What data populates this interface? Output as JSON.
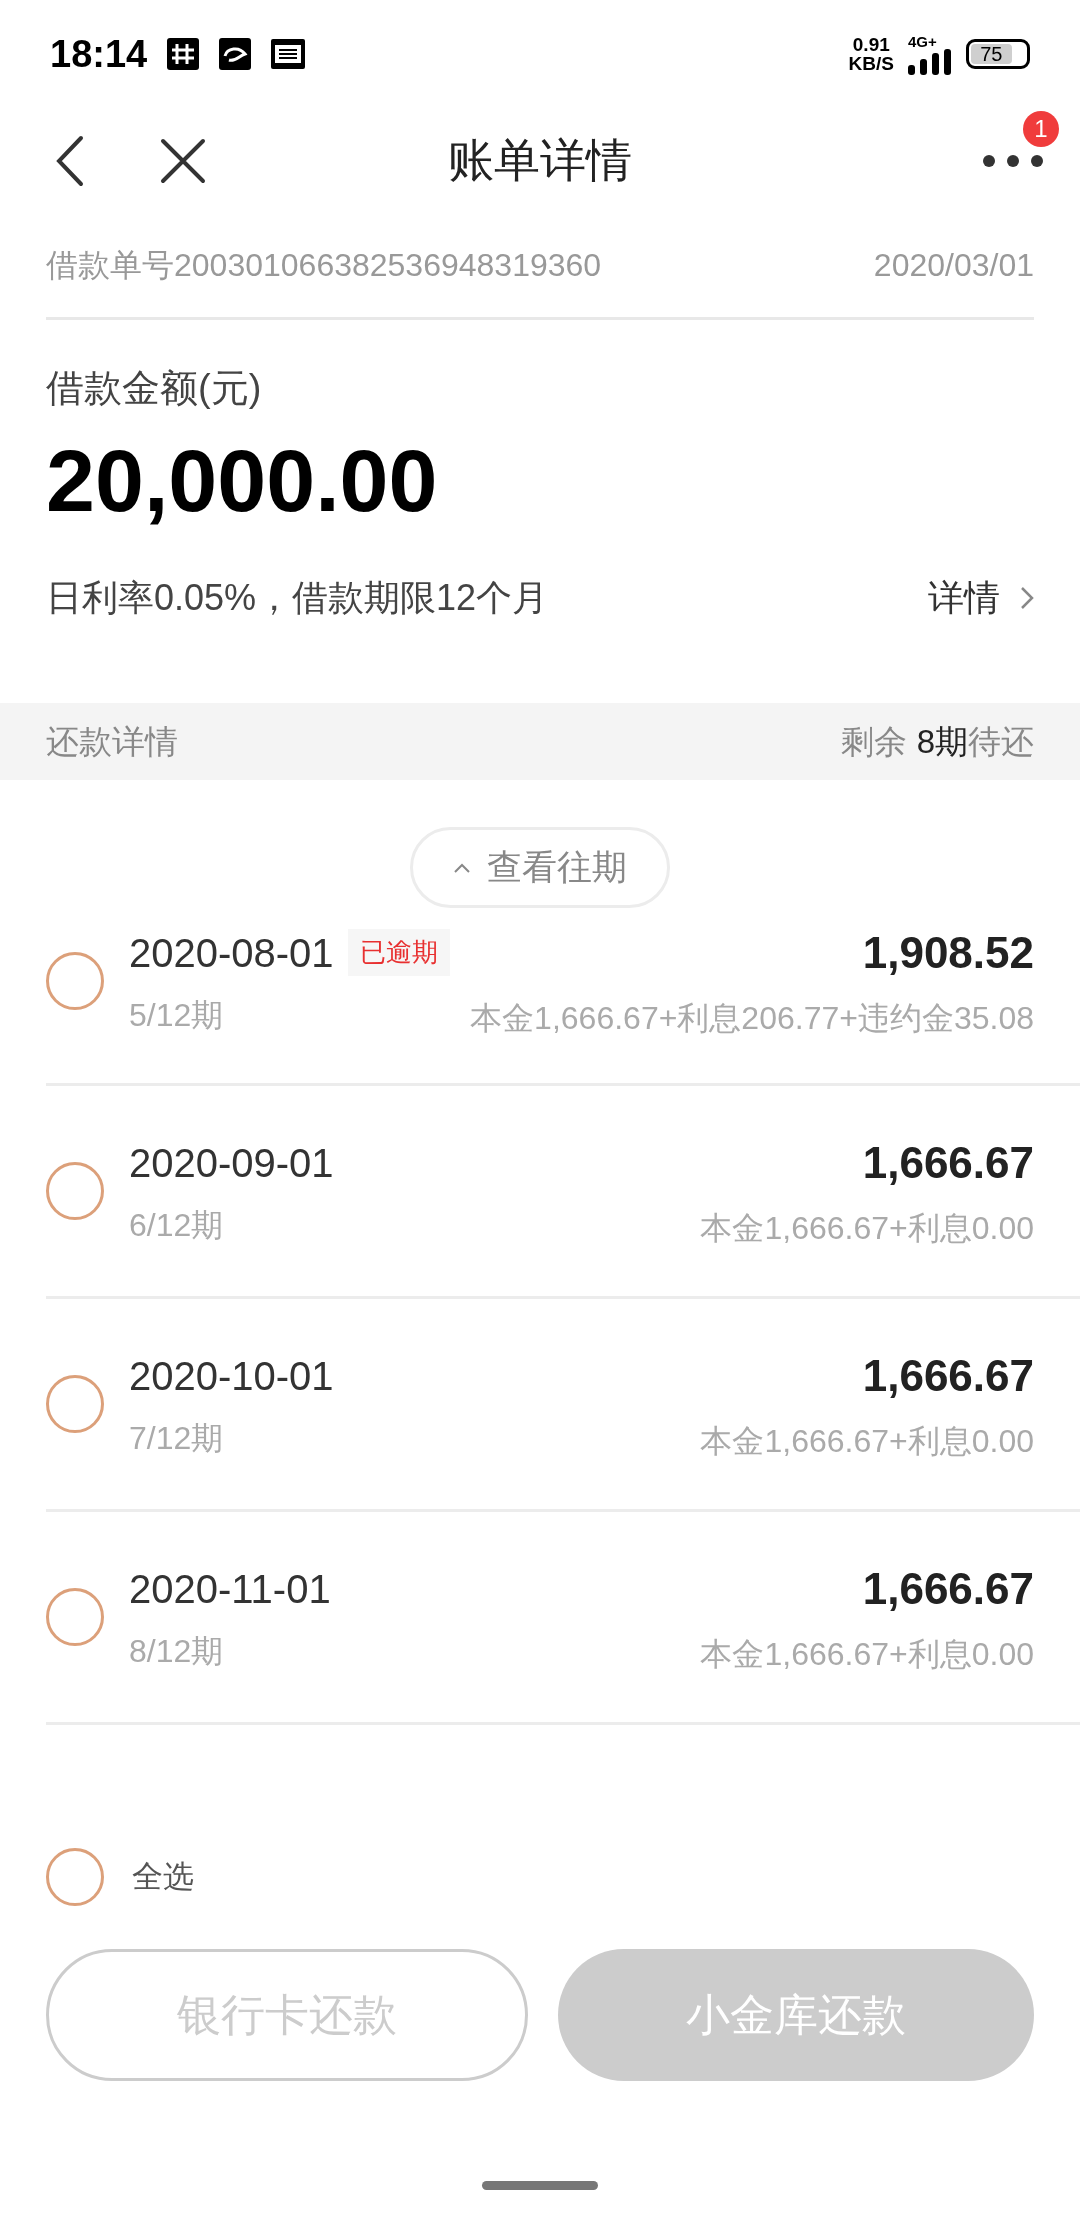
{
  "status_bar": {
    "time": "18:14",
    "speed": "0.91",
    "speed_unit": "KB/S",
    "network": "4G+",
    "battery": "75"
  },
  "nav": {
    "title": "账单详情",
    "badge": "1"
  },
  "loan": {
    "number": "借款单号200301066382536948319360",
    "date": "2020/03/01",
    "amount_label": "借款金额(元)",
    "amount": "20,000.00",
    "terms": "日利率0.05%，借款期限12个月",
    "detail_link": "详情"
  },
  "repay_header": {
    "title": "还款详情",
    "remaining_prefix": "剩余",
    "remaining_count": "8期",
    "remaining_suffix": "待还"
  },
  "history_button": "查看往期",
  "installments": [
    {
      "date": "2020-08-01",
      "tag": "已逾期",
      "period": "5/12期",
      "amount": "1,908.52",
      "breakdown": "本金1,666.67+利息206.77+违约金35.08",
      "checked": false
    },
    {
      "date": "2020-09-01",
      "period": "6/12期",
      "amount": "1,666.67",
      "breakdown": "本金1,666.67+利息0.00",
      "checked": false
    },
    {
      "date": "2020-10-01",
      "period": "7/12期",
      "amount": "1,666.67",
      "breakdown": "本金1,666.67+利息0.00",
      "checked": false
    },
    {
      "date": "2020-11-01",
      "period": "8/12期",
      "amount": "1,666.67",
      "breakdown": "本金1,666.67+利息0.00",
      "checked": false
    }
  ],
  "footer": {
    "select_all": {
      "label": "全选",
      "checked": false
    },
    "buttons": [
      {
        "label": "银行卡还款",
        "kind": "outline",
        "disabled": true
      },
      {
        "label": "小金库还款",
        "kind": "filled",
        "disabled": true
      }
    ]
  }
}
